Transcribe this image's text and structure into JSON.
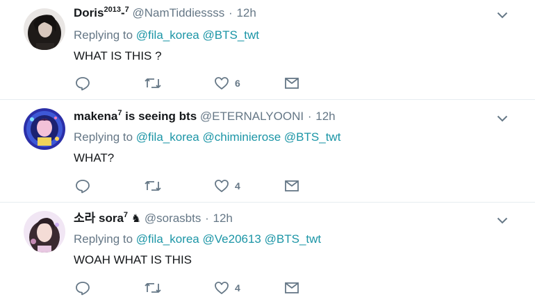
{
  "tweets": [
    {
      "display_name": "Doris",
      "name_sup": "2013",
      "name_suffix": "-",
      "name_sup2": "7",
      "handle": "@NamTiddiessss",
      "separator": "·",
      "time": "12h",
      "replying_label": "Replying to",
      "mentions": [
        "@fila_korea",
        "@BTS_twt"
      ],
      "text": "WHAT IS THIS ?",
      "likes": "6"
    },
    {
      "display_name": "makena",
      "name_sup": "7",
      "name_suffix": " is seeing bts",
      "handle": "@ETERNALYOONI",
      "separator": "·",
      "time": "12h",
      "replying_label": "Replying to",
      "mentions": [
        "@fila_korea",
        "@chiminierose",
        "@BTS_twt"
      ],
      "text": "WHAT?",
      "likes": "4"
    },
    {
      "display_name": "소라 sora",
      "name_sup": "7",
      "name_emoji": "♞",
      "handle": "@sorasbts",
      "separator": "·",
      "time": "12h",
      "replying_label": "Replying to",
      "mentions": [
        "@fila_korea",
        "@Ve20613",
        "@BTS_twt"
      ],
      "text": "WOAH WHAT IS THIS",
      "likes": "4"
    }
  ],
  "colors": {
    "link": "#1b95a6",
    "secondary_text": "#657786",
    "primary_text": "#14171a",
    "divider": "#e6ecf0"
  },
  "icons": [
    "reply-icon",
    "retweet-icon",
    "like-icon",
    "direct-message-icon",
    "chevron-down-icon"
  ]
}
